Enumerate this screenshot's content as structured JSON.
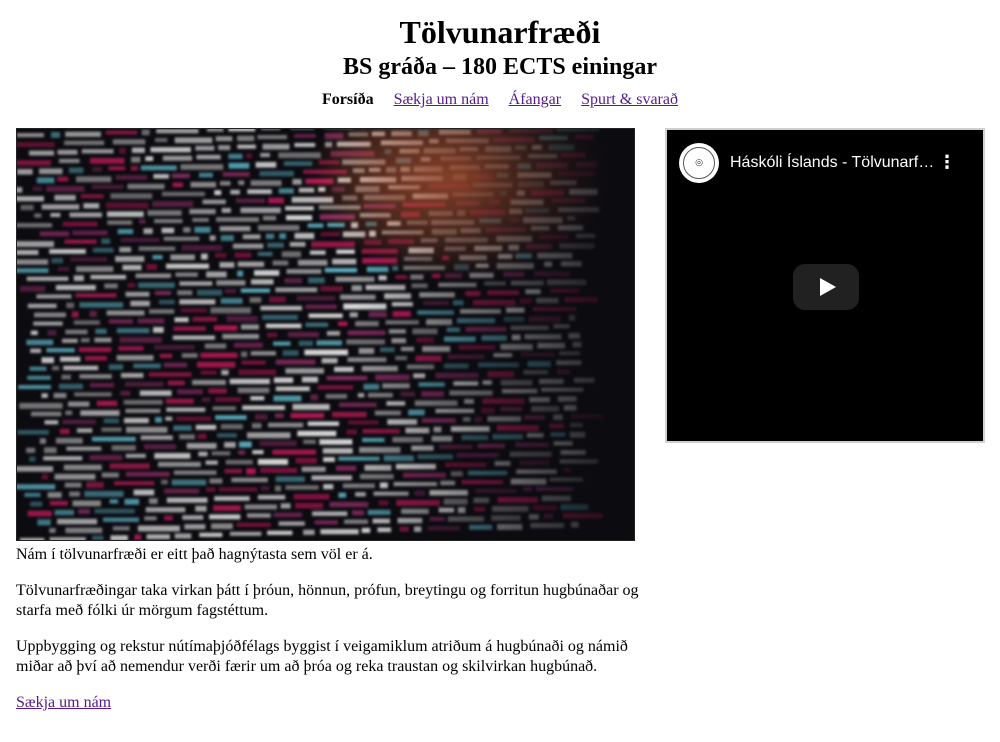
{
  "header": {
    "title": "Tölvunarfræði",
    "subtitle": "BS gráða – 180 ECTS einingar"
  },
  "nav": {
    "items": [
      {
        "label": "Forsíða",
        "current": true
      },
      {
        "label": "Sækja um nám",
        "current": false
      },
      {
        "label": "Áfangar",
        "current": false
      },
      {
        "label": "Spurt & svarað",
        "current": false
      }
    ]
  },
  "hero": {
    "icon": "code-photo"
  },
  "video": {
    "title": "Háskóli Íslands - Tölvunarfræði",
    "channel_logo": "university-seal-icon",
    "menu_icon": "kebab-menu-icon",
    "play_icon": "play-icon"
  },
  "content": {
    "paragraphs": [
      "Nám í tölvunarfræði er eitt það hagnýtasta sem völ er á.",
      "Tölvunarfræðingar taka virkan þátt í þróun, hönnun, prófun, breytingu og forritun hugbúnaðar og starfa með fólki úr mörgum fagstéttum.",
      "Uppbygging og rekstur nútímaþjóðfélags byggist í veigamiklum atriðum á hugbúnaði og námið miðar að því að nemendur verði færir um að þróa og reka traustan og skilvirkan hugbúnað."
    ],
    "cta_label": "Sækja um nám"
  },
  "colors": {
    "link": "#551a8b",
    "video_bg": "#000000",
    "code_pink": "#c2185b",
    "code_cyan": "#5fb7c9",
    "code_white": "#e8e8e8"
  }
}
